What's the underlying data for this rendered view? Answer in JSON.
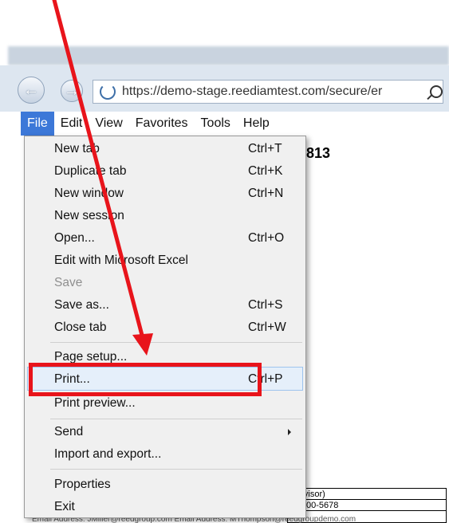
{
  "browser": {
    "url": "https://demo-stage.reediamtest.com/secure/er"
  },
  "menu_bar": {
    "items": [
      "File",
      "Edit",
      "View",
      "Favorites",
      "Tools",
      "Help"
    ]
  },
  "page": {
    "number_fragment": "813",
    "table_lines": [
      "pervisor)",
      "3) 500-5678"
    ],
    "bottom_line": "Email Address: JMiller@reedgroup.com  Email Address: MThompson@reedgroupdemo.com"
  },
  "file_menu": {
    "items": [
      {
        "label": "New tab",
        "shortcut": "Ctrl+T"
      },
      {
        "label": "Duplicate tab",
        "shortcut": "Ctrl+K"
      },
      {
        "label": "New window",
        "shortcut": "Ctrl+N"
      },
      {
        "label": "New session",
        "shortcut": ""
      },
      {
        "label": "Open...",
        "shortcut": "Ctrl+O"
      },
      {
        "label": "Edit with Microsoft Excel",
        "shortcut": ""
      },
      {
        "label": "Save",
        "shortcut": ""
      },
      {
        "label": "Save as...",
        "shortcut": "Ctrl+S"
      },
      {
        "label": "Close tab",
        "shortcut": "Ctrl+W"
      },
      {
        "label": "Page setup...",
        "shortcut": ""
      },
      {
        "label": "Print...",
        "shortcut": "Ctrl+P"
      },
      {
        "label": "Print preview...",
        "shortcut": ""
      },
      {
        "label": "Send",
        "shortcut": ""
      },
      {
        "label": "Import and export...",
        "shortcut": ""
      },
      {
        "label": "Properties",
        "shortcut": ""
      },
      {
        "label": "Exit",
        "shortcut": ""
      }
    ]
  },
  "colors": {
    "annotation": "#e8141b",
    "menu_active": "#3c78d8"
  }
}
